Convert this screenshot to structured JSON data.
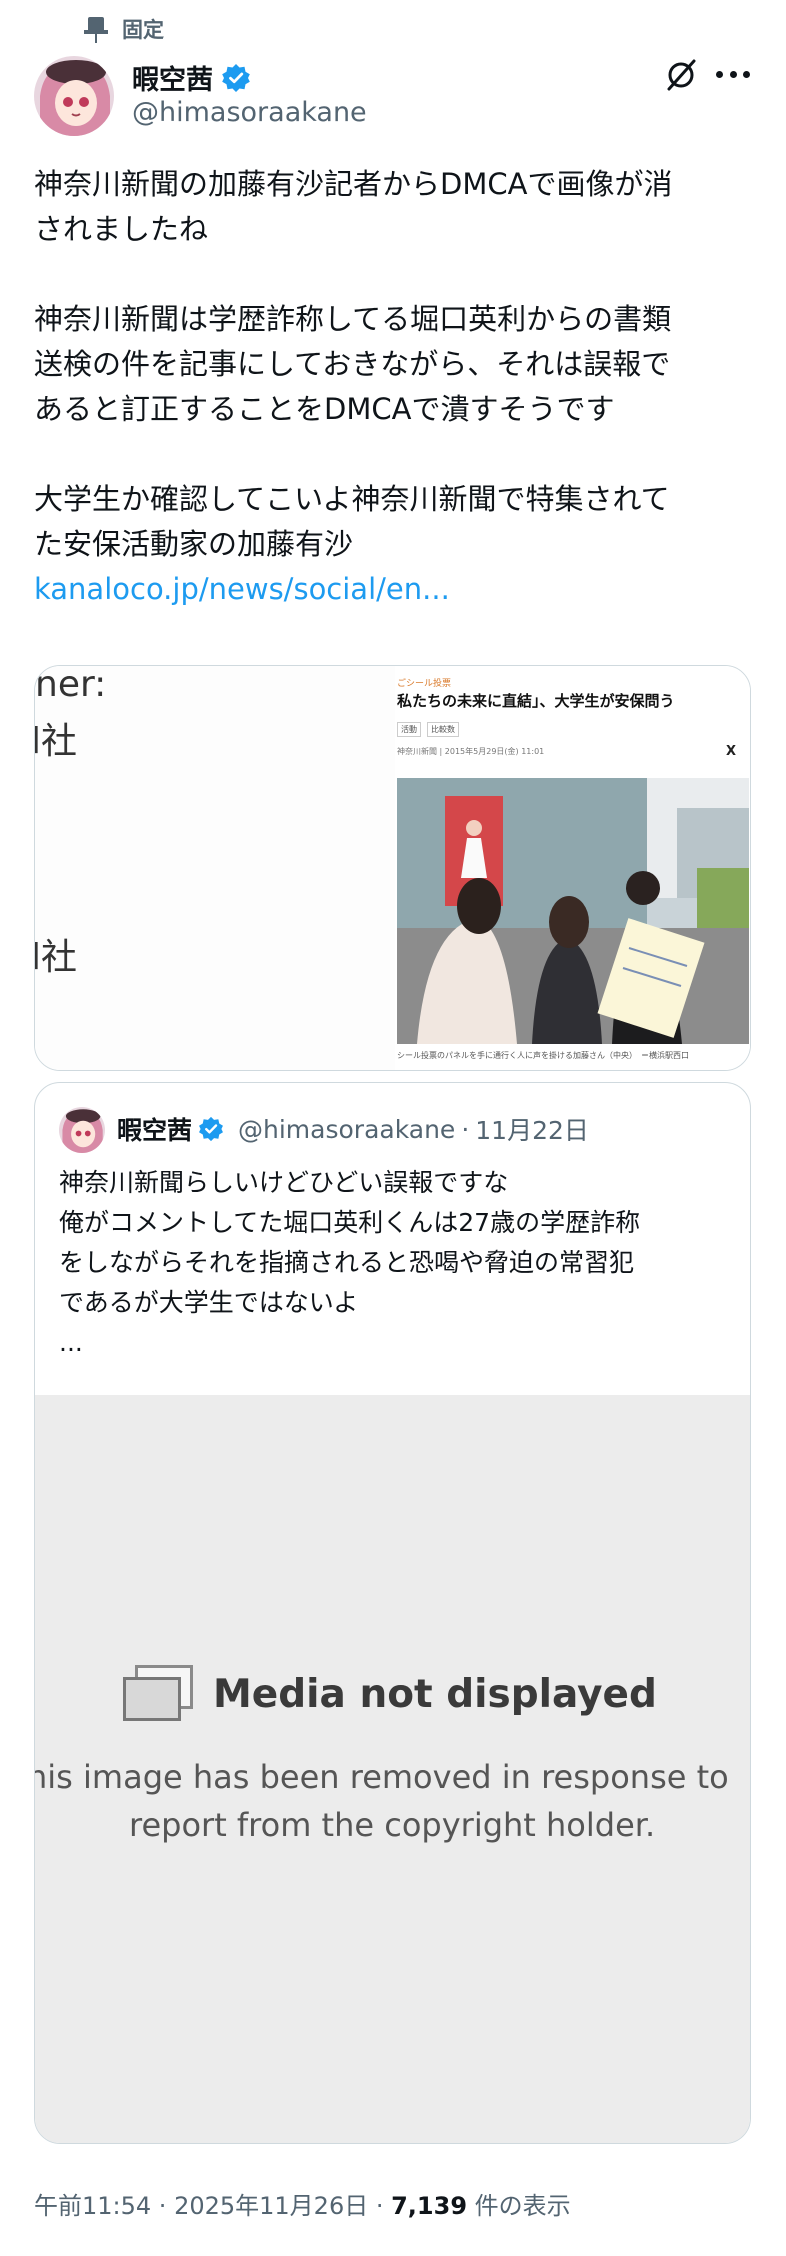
{
  "pinned": {
    "label": "固定",
    "icon": "pin-icon"
  },
  "author": {
    "display_name": "暇空茜",
    "handle": "@himasoraakane",
    "verified": true,
    "verified_color": "#1d9bf0"
  },
  "tweet": {
    "paragraphs": [
      [
        "神奈川新聞の加藤有沙記者からDMCAで画像が消",
        "されましたね"
      ],
      [
        "神奈川新聞は学歴詐称してる堀口英利からの書類",
        "送検の件を記事にしておきながら、それは誤報で",
        "あると訂正することをDMCAで潰すそうです"
      ],
      [
        "大学生か確認してこいよ神奈川新聞で特集されて",
        "た安保活動家の加藤有沙"
      ]
    ],
    "link_text": "kanaloco.jp/news/social/en..."
  },
  "media": {
    "doc_fragments": [
      "ner:",
      "l社",
      "l社"
    ],
    "article": {
      "category": "ごシール投票",
      "title": "私たちの未来に直結」、大学生が安保問う",
      "tags": [
        "活動",
        "比較数"
      ],
      "date": "神奈川新聞 | 2015年5月29日(金) 11:01",
      "share_icon": "X",
      "caption": "シール投票のパネルを手に通行く人に声を掛ける加藤さん（中央）　＝横浜駅西口"
    }
  },
  "quote": {
    "display_name": "暇空茜",
    "handle": "@himasoraakane",
    "separator": "·",
    "date": "11月22日",
    "lines": [
      "神奈川新聞らしいけどひどい誤報ですな",
      "俺がコメントしてた堀口英利くんは27歳の学歴詐称",
      "をしながらそれを指摘されると恐喝や脅迫の常習犯",
      "であるが大学生ではないよ",
      "..."
    ],
    "removed": {
      "title": "Media not displayed",
      "line1": "his image has been removed in response to",
      "line2": "report from the copyright holder."
    }
  },
  "footer": {
    "time": "午前11:54",
    "sep1": " · ",
    "date": "2025年11月26日",
    "sep2": " · ",
    "views": "7,139",
    "views_label": " 件の表示"
  },
  "colors": {
    "link": "#1d9bf0",
    "secondary_text": "#536471",
    "border": "#cfd9de",
    "removed_bg": "#ececec"
  }
}
